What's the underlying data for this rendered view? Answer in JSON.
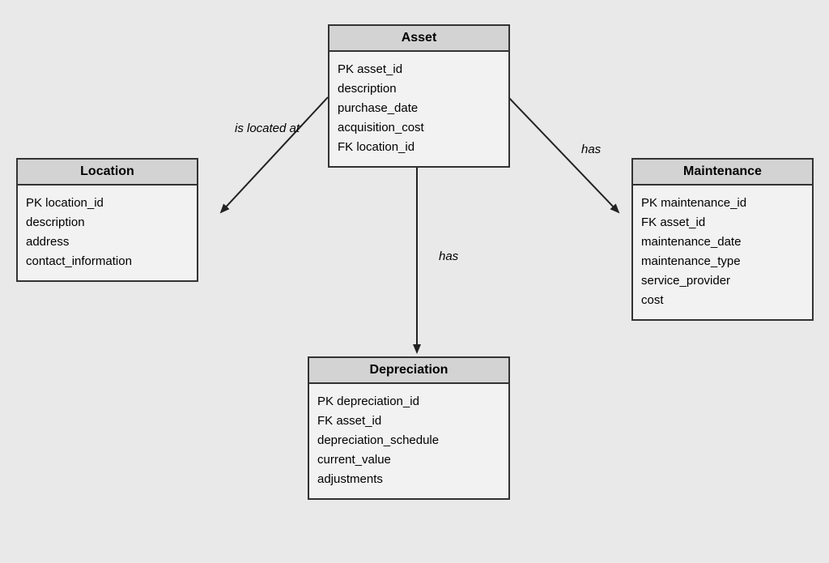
{
  "entities": {
    "asset": {
      "title": "Asset",
      "attrs": [
        "PK asset_id",
        "description",
        "purchase_date",
        "acquisition_cost",
        "FK location_id"
      ]
    },
    "location": {
      "title": "Location",
      "attrs": [
        "PK location_id",
        "description",
        "address",
        "contact_information"
      ]
    },
    "maintenance": {
      "title": "Maintenance",
      "attrs": [
        "PK maintenance_id",
        "FK asset_id",
        "maintenance_date",
        "maintenance_type",
        "service_provider",
        "cost"
      ]
    },
    "depreciation": {
      "title": "Depreciation",
      "attrs": [
        "PK depreciation_id",
        "FK asset_id",
        "depreciation_schedule",
        "current_value",
        "adjustments"
      ]
    }
  },
  "relationships": {
    "asset_location": "is located at",
    "asset_depreciation": "has",
    "asset_maintenance": "has"
  }
}
